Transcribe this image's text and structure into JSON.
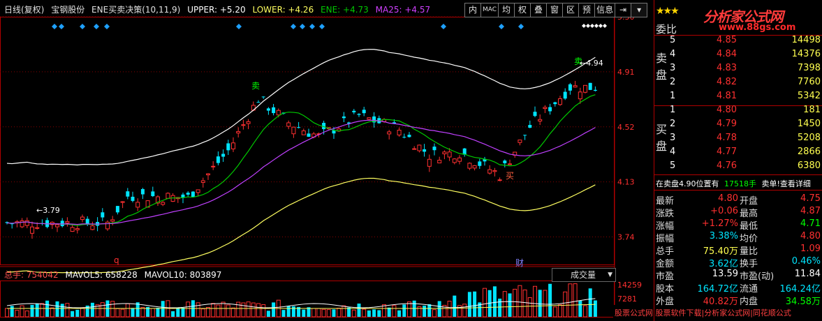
{
  "header": {
    "period": "日线(复权)",
    "stock_name": "宝钢股份",
    "indicator": "ENE买卖决策(10,11,9)",
    "upper": "UPPER: +5.20",
    "lower": "LOWER: +4.26",
    "ene": "ENE: +4.73",
    "ma25": "MA25: +4.57"
  },
  "toolbar": {
    "buttons": [
      "内",
      "MAC",
      "均",
      "权",
      "叠",
      "窗",
      "区",
      "预",
      "信息",
      "⇥",
      "▾"
    ]
  },
  "price_axis": {
    "labels": [
      "5.30",
      "4.91",
      "4.52",
      "4.13",
      "3.74"
    ]
  },
  "annotations": {
    "sell": "卖",
    "buy": "买",
    "marker_q": "q",
    "marker_cai": "财",
    "low_value": "←3.79",
    "high_value": "←4.94"
  },
  "volume_panel": {
    "label": "总手: 754042",
    "mavol5": "MAVOL5: 658228",
    "mavol10": "MAVOL10: 803897",
    "dropdown": "成交量",
    "axis_labels": [
      "14259",
      "7281"
    ],
    "footer_text": "股票公式网  股票软件下载|分析家公式网|同花顺公式"
  },
  "right_panel": {
    "logo_text": "分析家公式网",
    "logo_url": "www.88gs.com",
    "weibi_label": "委比",
    "sell_label": "卖盘",
    "buy_label": "买盘",
    "sell_orders": [
      {
        "level": "5",
        "price": "4.85",
        "volume": "14498"
      },
      {
        "level": "4",
        "price": "4.84",
        "volume": "14376"
      },
      {
        "level": "3",
        "price": "4.83",
        "volume": "7398"
      },
      {
        "level": "2",
        "price": "4.82",
        "volume": "7760"
      },
      {
        "level": "1",
        "price": "4.81",
        "volume": "5342"
      }
    ],
    "buy_orders": [
      {
        "level": "1",
        "price": "4.80",
        "volume": "181"
      },
      {
        "level": "2",
        "price": "4.79",
        "volume": "1450"
      },
      {
        "level": "3",
        "price": "4.78",
        "volume": "5208"
      },
      {
        "level": "4",
        "price": "4.77",
        "volume": "2866"
      },
      {
        "level": "5",
        "price": "4.76",
        "volume": "6380"
      }
    ],
    "notice_left": "在卖盘4.90位置有",
    "notice_vol": "17518手",
    "notice_right": "卖单!查看详细",
    "stats": [
      {
        "k1": "最新",
        "v1": "4.80",
        "c1": "red",
        "k2": "开盘",
        "v2": "4.75",
        "c2": "red"
      },
      {
        "k1": "涨跌",
        "v1": "+0.06",
        "c1": "red",
        "k2": "最高",
        "v2": "4.87",
        "c2": "red"
      },
      {
        "k1": "涨幅",
        "v1": "+1.27%",
        "c1": "red",
        "k2": "最低",
        "v2": "4.71",
        "c2": "green"
      },
      {
        "k1": "振幅",
        "v1": "3.38%",
        "c1": "cyan",
        "k2": "均价",
        "v2": "4.80",
        "c2": "red"
      },
      {
        "k1": "总手",
        "v1": "75.40万",
        "c1": "yellow",
        "k2": "量比",
        "v2": "1.09",
        "c2": "red"
      },
      {
        "k1": "金额",
        "v1": "3.62亿",
        "c1": "cyan",
        "k2": "换手",
        "v2": "0.46%",
        "c2": "cyan"
      },
      {
        "k1": "市盈",
        "v1": "13.59",
        "c1": "white",
        "k2": "市盈(动)",
        "v2": "11.84",
        "c2": "white"
      },
      {
        "k1": "股本",
        "v1": "164.72亿",
        "c1": "cyan",
        "k2": "流通",
        "v2": "164.24亿",
        "c2": "cyan"
      },
      {
        "k1": "外盘",
        "v1": "40.82万",
        "c1": "red",
        "k2": "内盘",
        "v2": "34.58万",
        "c2": "green"
      }
    ]
  }
}
